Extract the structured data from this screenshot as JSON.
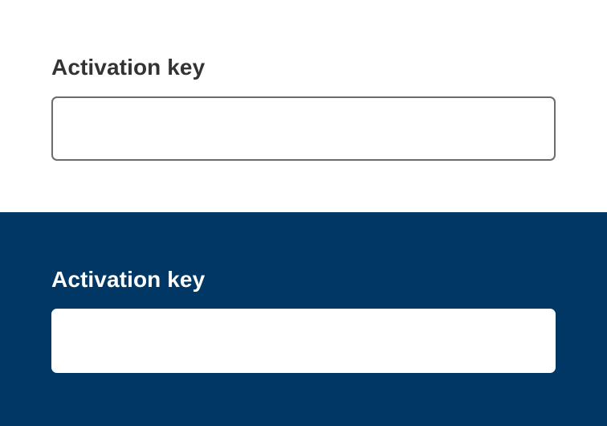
{
  "light_section": {
    "label": "Activation key",
    "input_value": "",
    "input_placeholder": ""
  },
  "dark_section": {
    "label": "Activation key",
    "input_value": "",
    "input_placeholder": ""
  },
  "colors": {
    "light_background": "#ffffff",
    "dark_background": "#003764",
    "light_label": "#333333",
    "dark_label": "#ffffff",
    "light_input_border": "#6b6b6b"
  }
}
